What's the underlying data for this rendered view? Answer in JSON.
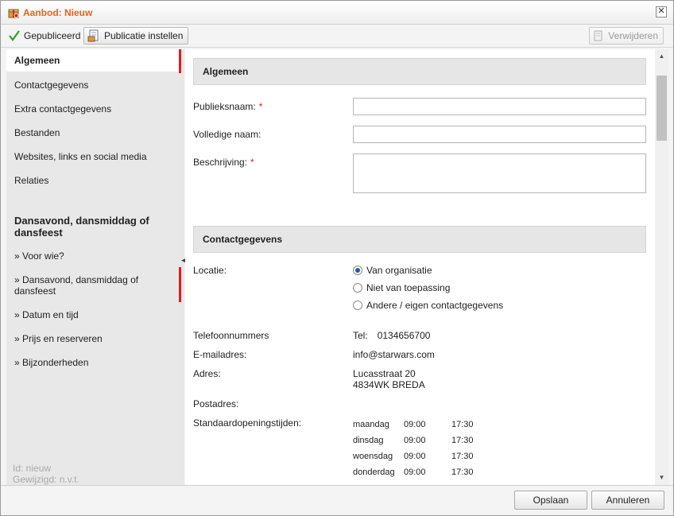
{
  "window": {
    "title": "Aanbod: Nieuw",
    "close_symbol": "✕"
  },
  "toolbar": {
    "published_label": "Gepubliceerd",
    "publicatie_label": "Publicatie instellen",
    "delete_label": "Verwijderen"
  },
  "sidebar": {
    "items": [
      {
        "label": "Algemeen"
      },
      {
        "label": "Contactgegevens"
      },
      {
        "label": "Extra contactgegevens"
      },
      {
        "label": "Bestanden"
      },
      {
        "label": "Websites, links en social media"
      },
      {
        "label": "Relaties"
      }
    ],
    "heading": "Dansavond, dansmiddag of dansfeest",
    "subitems": [
      {
        "label": "» Voor wie?"
      },
      {
        "label": "» Dansavond, dansmiddag of dansfeest"
      },
      {
        "label": "» Datum en tijd"
      },
      {
        "label": "» Prijs en reserveren"
      },
      {
        "label": "» Bijzonderheden"
      }
    ],
    "meta": {
      "id": "Id: nieuw",
      "modified": "Gewijzigd: n.v.t."
    }
  },
  "algemeen": {
    "title": "Algemeen",
    "publieksnaam_label": "Publieksnaam:",
    "volledige_naam_label": "Volledige naam:",
    "beschrijving_label": "Beschrijving:",
    "required_mark": "*",
    "publieksnaam_value": "",
    "volledige_naam_value": "",
    "beschrijving_value": ""
  },
  "contact": {
    "title": "Contactgegevens",
    "locatie_label": "Locatie:",
    "locatie_options": [
      {
        "label": "Van organisatie",
        "checked": true
      },
      {
        "label": "Niet van toepassing",
        "checked": false
      },
      {
        "label": "Andere / eigen contactgegevens",
        "checked": false
      }
    ],
    "telefoon_label": "Telefoonnummers",
    "telefoon_prefix": "Tel:",
    "telefoon_value": "0134656700",
    "email_label": "E-mailadres:",
    "email_value": "info@starwars.com",
    "adres_label": "Adres:",
    "adres_line1": "Lucasstraat 20",
    "adres_line2": "4834WK BREDA",
    "postadres_label": "Postadres:",
    "opening_label": "Standaardopeningstijden:",
    "hours": [
      {
        "day": "maandag",
        "open": "09:00",
        "close": "17:30"
      },
      {
        "day": "dinsdag",
        "open": "09:00",
        "close": "17:30"
      },
      {
        "day": "woensdag",
        "open": "09:00",
        "close": "17:30"
      },
      {
        "day": "donderdag",
        "open": "09:00",
        "close": "17:30"
      }
    ]
  },
  "footer": {
    "save_label": "Opslaan",
    "cancel_label": "Annuleren"
  },
  "colors": {
    "title": "#e8641b",
    "accent": "#e5191b",
    "check": "#2e9e2e"
  }
}
